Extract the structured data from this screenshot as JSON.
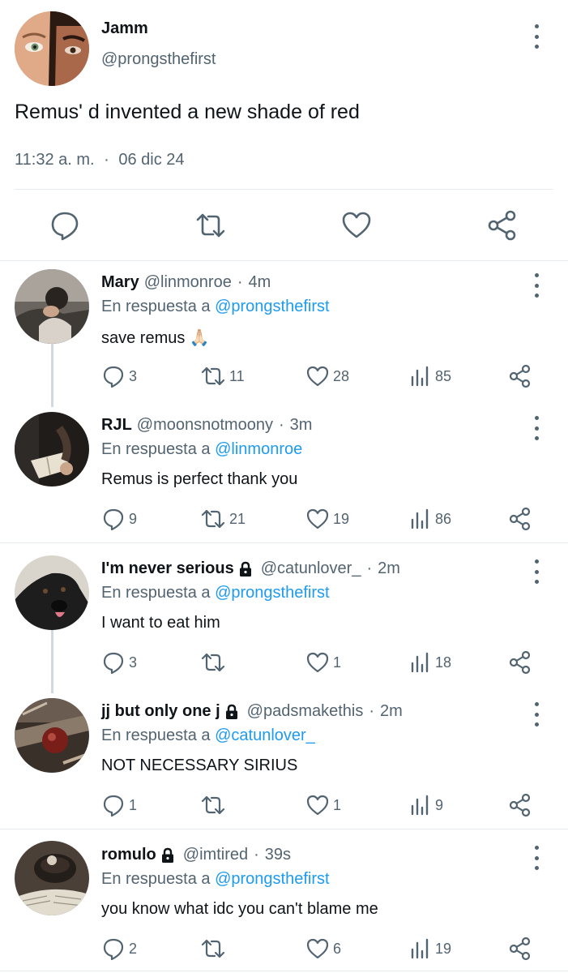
{
  "main_tweet": {
    "author_name": "Jamm",
    "author_handle": "@prongsthefirst",
    "text": "Remus' d invented a new shade of red",
    "timestamp": "11:32 a. m.",
    "separator": "·",
    "date": "06 dic 24",
    "actions": [
      "reply-icon",
      "retweet-icon",
      "like-icon",
      "share-icon"
    ]
  },
  "in_reply_prefix": "En respuesta a",
  "replies": [
    {
      "name": "Mary",
      "handle": "@linmonroe",
      "time": "4m",
      "locked": false,
      "reply_to": "@prongsthefirst",
      "text": "save remus 🙏🏻",
      "replies": "3",
      "retweets": "11",
      "likes": "28",
      "views": "85"
    },
    {
      "name": "RJL",
      "handle": "@moonsnotmoony",
      "time": "3m",
      "locked": false,
      "reply_to": "@linmonroe",
      "text": "Remus is perfect thank you",
      "replies": "9",
      "retweets": "21",
      "likes": "19",
      "views": "86"
    },
    {
      "name": "I'm never serious",
      "handle": "@catunlover_",
      "time": "2m",
      "locked": true,
      "reply_to": "@prongsthefirst",
      "text": "I want to eat him",
      "replies": "3",
      "retweets": "",
      "likes": "1",
      "views": "18"
    },
    {
      "name": "jj but only one j",
      "handle": "@padsmakethis",
      "time": "2m",
      "locked": true,
      "reply_to": "@catunlover_",
      "text": "NOT NECESSARY SIRIUS",
      "replies": "1",
      "retweets": "",
      "likes": "1",
      "views": "9"
    },
    {
      "name": "romulo",
      "handle": "@imtired",
      "time": "39s",
      "locked": true,
      "reply_to": "@prongsthefirst",
      "text": "you know what idc you can't blame me",
      "replies": "2",
      "retweets": "",
      "likes": "6",
      "views": "19"
    }
  ],
  "colors": {
    "text": "#0f1419",
    "secondary": "#536471",
    "mention": "#1d9bf0",
    "divider": "#e6ecf0",
    "thread_line": "#cfd9de"
  }
}
